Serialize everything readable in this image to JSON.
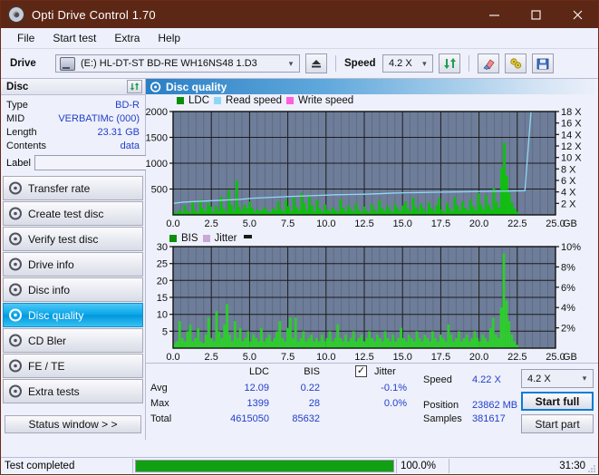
{
  "window": {
    "title": "Opti Drive Control 1.70",
    "icon": "disc-icon",
    "minimize": "minimize-icon",
    "maximize": "maximize-icon",
    "close": "close-icon"
  },
  "menu": {
    "items": [
      "File",
      "Start test",
      "Extra",
      "Help"
    ]
  },
  "toolbar": {
    "drive_label": "Drive",
    "drive_value": "(E:)  HL-DT-ST BD-RE  WH16NS48 1.D3",
    "eject_icon": "eject-icon",
    "speed_label": "Speed",
    "speed_value": "4.2 X",
    "refresh_icon": "refresh-icon",
    "erase_icon": "eraser-icon",
    "tools_icon": "tools-icon",
    "save_icon": "save-icon"
  },
  "disc_panel": {
    "title": "Disc",
    "refresh_icon": "refresh-icon",
    "rows": [
      {
        "key": "Type",
        "value": "BD-R"
      },
      {
        "key": "MID",
        "value": "VERBATIMc (000)"
      },
      {
        "key": "Length",
        "value": "23.31 GB"
      },
      {
        "key": "Contents",
        "value": "data"
      }
    ],
    "label_key": "Label",
    "label_value": "",
    "label_placeholder": "",
    "disc_icon": "cd-icon"
  },
  "sidebar": {
    "items": [
      {
        "label": "Transfer rate",
        "icon": "disc-icon",
        "active": false
      },
      {
        "label": "Create test disc",
        "icon": "disc-icon",
        "active": false
      },
      {
        "label": "Verify test disc",
        "icon": "disc-icon",
        "active": false
      },
      {
        "label": "Drive info",
        "icon": "disc-icon",
        "active": false
      },
      {
        "label": "Disc info",
        "icon": "disc-icon",
        "active": false
      },
      {
        "label": "Disc quality",
        "icon": "disc-icon",
        "active": true
      },
      {
        "label": "CD Bler",
        "icon": "disc-icon",
        "active": false
      },
      {
        "label": "FE / TE",
        "icon": "disc-icon",
        "active": false
      },
      {
        "label": "Extra tests",
        "icon": "disc-icon",
        "active": false
      }
    ],
    "status_window": "Status window > >"
  },
  "pane": {
    "title": "Disc quality",
    "icon": "disc-icon"
  },
  "stats": {
    "col_headers": [
      "LDC",
      "BIS"
    ],
    "rows": [
      {
        "label": "Avg",
        "ldc": "12.09",
        "bis": "0.22",
        "jitter": "-0.1%"
      },
      {
        "label": "Max",
        "ldc": "1399",
        "bis": "28",
        "jitter": "0.0%"
      },
      {
        "label": "Total",
        "ldc": "4615050",
        "bis": "85632",
        "jitter": ""
      }
    ],
    "jitter_label": "Jitter",
    "jitter_checked": true,
    "speed_label": "Speed",
    "speed_value": "4.22 X",
    "position_label": "Position",
    "position_value": "23862 MB",
    "samples_label": "Samples",
    "samples_value": "381617",
    "speed_select": "4.2 X",
    "start_full": "Start full",
    "start_part": "Start part"
  },
  "statusbar": {
    "message": "Test completed",
    "progress_text": "100.0%",
    "progress_percent": 100,
    "elapsed": "31:30"
  },
  "colors": {
    "titlebar": "#5d2716",
    "accent_blue": "#0a7cd4",
    "value_blue": "#2340c8",
    "plot_bg": "#6e7d99",
    "ldc_green": "#0fbf0f",
    "bis_green": "#2ecc2e",
    "read_speed": "#8fd8f5",
    "write_speed": "#ff5ee0",
    "jitter": "#c9a7d6",
    "progress_green": "#11a011"
  },
  "chart_data": [
    {
      "type": "area",
      "title": "LDC / Read speed",
      "xlabel": "GB",
      "ylabel": "LDC",
      "xlim": [
        0.0,
        25.0
      ],
      "ylim": [
        0,
        2000
      ],
      "y2lim": [
        0,
        18
      ],
      "y2label": "X",
      "grid": true,
      "legend_position": "top-left",
      "legend": [
        {
          "name": "LDC",
          "color": "#0b8f0b"
        },
        {
          "name": "Read speed",
          "color": "#8fd8f5"
        },
        {
          "name": "Write speed",
          "color": "#ff5ee0"
        }
      ],
      "xticks": [
        "0.0",
        "2.5",
        "5.0",
        "7.5",
        "10.0",
        "12.5",
        "15.0",
        "17.5",
        "20.0",
        "22.5",
        "25.0"
      ],
      "yticks": [
        "2000",
        "1500",
        "1000",
        "500"
      ],
      "y2ticks": [
        "18 X",
        "16 X",
        "14 X",
        "12 X",
        "10 X",
        "8 X",
        "6 X",
        "4 X",
        "2 X"
      ],
      "series": [
        {
          "name": "LDC",
          "color": "#0fbf0f",
          "type": "bar",
          "x_end": 23.6,
          "values": [
            60,
            40,
            95,
            55,
            180,
            70,
            45,
            260,
            90,
            50,
            300,
            140,
            70,
            240,
            160,
            55,
            180,
            90,
            350,
            120,
            60,
            480,
            200,
            90,
            660,
            150,
            80,
            200,
            120,
            260,
            140,
            60,
            110,
            70,
            95,
            150,
            70,
            50,
            130,
            90,
            260,
            110,
            70,
            300,
            170,
            80,
            340,
            150,
            90,
            420,
            230,
            100,
            380,
            180,
            70,
            290,
            120,
            60,
            200,
            95,
            70,
            140,
            90,
            55,
            300,
            130,
            70,
            180,
            110,
            70,
            230,
            95,
            50,
            160,
            80,
            45,
            210,
            105,
            60,
            290,
            130,
            75,
            170,
            100,
            55,
            220,
            120,
            70,
            180,
            260,
            110,
            70,
            330,
            150,
            80,
            220,
            120,
            60,
            250,
            140,
            75,
            190,
            320,
            105,
            60,
            230,
            130,
            70,
            340,
            180,
            95,
            260,
            140,
            80,
            300,
            160,
            90,
            420,
            200,
            110,
            380,
            190,
            100,
            520,
            260,
            140,
            900,
            1399,
            760,
            420,
            240,
            120,
            60,
            0,
            0,
            0,
            0,
            0,
            0
          ]
        },
        {
          "name": "Read speed",
          "color": "#8fd8f5",
          "type": "line",
          "x": [
            0.0,
            0.6,
            1.2,
            2.0,
            2.8,
            3.6,
            4.4,
            5.2,
            6.0,
            6.8,
            7.6,
            8.6,
            9.6,
            10.6,
            11.6,
            12.6,
            13.6,
            14.4,
            15.2,
            16.2,
            17.2,
            18.4,
            19.6,
            20.8,
            22.0,
            23.0,
            23.4,
            23.5,
            23.6
          ],
          "values": [
            2.0,
            2.2,
            2.3,
            2.4,
            2.5,
            2.6,
            2.7,
            2.9,
            3.0,
            3.1,
            3.2,
            3.3,
            3.4,
            3.5,
            3.55,
            3.6,
            3.7,
            3.8,
            3.85,
            3.9,
            3.95,
            4.0,
            4.05,
            4.1,
            4.15,
            4.2,
            18.0,
            18.0,
            18.0
          ]
        },
        {
          "name": "Write speed",
          "color": "#ff5ee0",
          "type": "line",
          "x": [],
          "values": []
        }
      ]
    },
    {
      "type": "area",
      "title": "BIS / Jitter",
      "xlabel": "GB",
      "ylabel": "BIS",
      "xlim": [
        0.0,
        25.0
      ],
      "ylim": [
        0,
        30
      ],
      "y2lim": [
        0,
        10
      ],
      "y2label": "%",
      "grid": true,
      "legend_position": "top-left",
      "legend": [
        {
          "name": "BIS",
          "color": "#0b8f0b"
        },
        {
          "name": "Jitter",
          "color": "#c9a7d6"
        }
      ],
      "xticks": [
        "0.0",
        "2.5",
        "5.0",
        "7.5",
        "10.0",
        "12.5",
        "15.0",
        "17.5",
        "20.0",
        "22.5",
        "25.0"
      ],
      "yticks": [
        "30",
        "25",
        "20",
        "15",
        "10",
        "5"
      ],
      "y2ticks": [
        "10%",
        "8%",
        "6%",
        "4%",
        "2%"
      ],
      "series": [
        {
          "name": "BIS",
          "color": "#2ecc2e",
          "type": "bar",
          "x_end": 23.6,
          "values": [
            1.5,
            2,
            8,
            3,
            2,
            5,
            7,
            2,
            3,
            6,
            2,
            1.5,
            4,
            9,
            3,
            2,
            11,
            5,
            3,
            7,
            13,
            4,
            2,
            8,
            3,
            6,
            2,
            3,
            5,
            2,
            4,
            3,
            2,
            6,
            2,
            3,
            4,
            2,
            3,
            5,
            8,
            3,
            2,
            6,
            9,
            3,
            9,
            2,
            3,
            5,
            2,
            3,
            4,
            2,
            3,
            2,
            4,
            2,
            3,
            5,
            2,
            3,
            7,
            3,
            2,
            4,
            2,
            3,
            5,
            2,
            3,
            4,
            2,
            3,
            5,
            3,
            2,
            4,
            3,
            2,
            5,
            3,
            2,
            4,
            2,
            3,
            6,
            3,
            2,
            4,
            3,
            2,
            5,
            3,
            2,
            4,
            3,
            2,
            5,
            3,
            2,
            4,
            3,
            2,
            7,
            4,
            2,
            3,
            5,
            2,
            3,
            4,
            2,
            3,
            5,
            3,
            2,
            4,
            3,
            2,
            6,
            9,
            4,
            3,
            12,
            28,
            14,
            8,
            4,
            2,
            1,
            0,
            0,
            0,
            0,
            0,
            0
          ]
        },
        {
          "name": "Jitter",
          "color": "#c9a7d6",
          "type": "line",
          "x": [],
          "values": []
        }
      ]
    }
  ]
}
